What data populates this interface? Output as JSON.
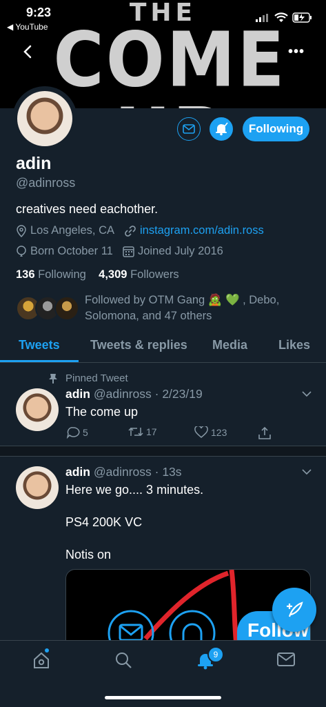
{
  "status_bar": {
    "time": "9:23",
    "back_app": "◀ YouTube"
  },
  "banner": {
    "line1": "THE",
    "line2": "COME UP"
  },
  "header": {
    "more_icon": "more-icon"
  },
  "profile": {
    "name": "adin",
    "handle": "@adinross",
    "bio": "creatives need eachother.",
    "location": "Los Angeles, CA",
    "link": "instagram.com/adin.ross",
    "birthday": "Born October 11",
    "joined": "Joined July 2016",
    "following_count": "136",
    "following_label": "Following",
    "followers_count": "4,309",
    "followers_label": "Followers",
    "followed_by": "Followed by OTM Gang 🧟 💚 , Debo, Solomona, and 47 others",
    "following_button": "Following"
  },
  "tabs": [
    {
      "label": "Tweets"
    },
    {
      "label": "Tweets & replies"
    },
    {
      "label": "Media"
    },
    {
      "label": "Likes"
    }
  ],
  "tweets": [
    {
      "pinned_label": "Pinned Tweet",
      "name": "adin",
      "meta": "@adinross · 2/23/19",
      "text": "The come up",
      "replies": "5",
      "retweets": "17",
      "likes": "123"
    },
    {
      "name": "adin",
      "meta": "@adinross · 13s",
      "line1": "Here we go.... 3 minutes.",
      "line2": "PS4 200K VC",
      "line3": "Notis on",
      "media_follow_label": "Follow"
    }
  ],
  "bottom_nav": {
    "notification_count": "9"
  },
  "colors": {
    "background": "#15202b",
    "accent": "#1da1f2",
    "muted": "#8899a6",
    "border": "#38444d"
  }
}
